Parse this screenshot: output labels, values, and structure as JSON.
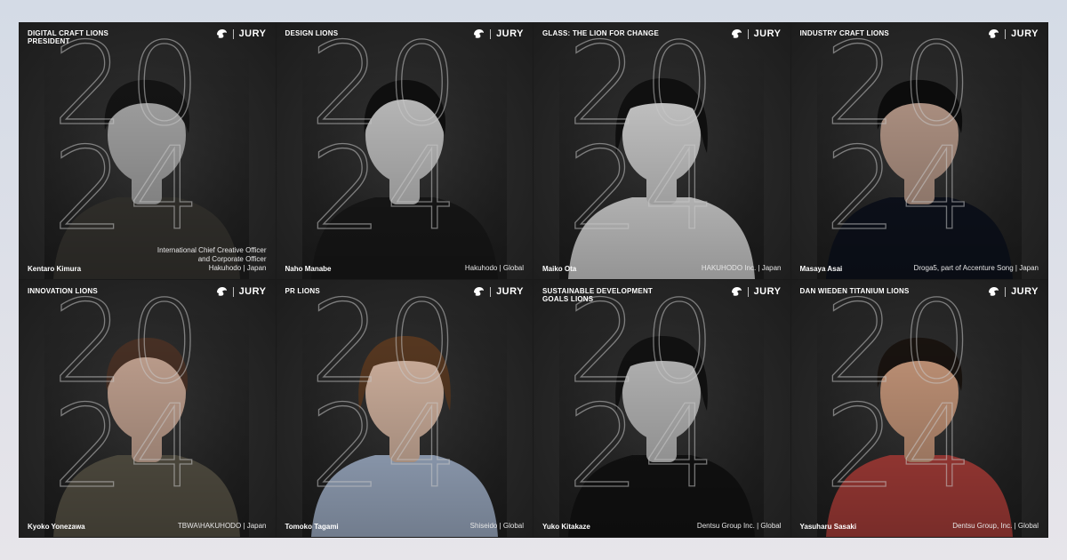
{
  "badge": {
    "label": "JURY"
  },
  "year": {
    "top": "20",
    "bottom": "24"
  },
  "cards": [
    {
      "category": "DIGITAL CRAFT LIONS\nPRESIDENT",
      "name": "Kentaro Kimura",
      "affiliation": "International Chief Creative Officer\nand Corporate Officer\nHakuhodo | Japan",
      "shirt": "#3c3a35",
      "skin": "#a9a9a9",
      "hair": "#151515",
      "hairstyle": "short"
    },
    {
      "category": "DESIGN LIONS",
      "name": "Naho Manabe",
      "affiliation": "Hakuhodo | Global",
      "shirt": "#1b1b1b",
      "skin": "#c4c4c4",
      "hair": "#101010",
      "hairstyle": "pulled"
    },
    {
      "category": "GLASS: THE LION FOR CHANGE",
      "name": "Maiko Ota",
      "affiliation": "HAKUHODO Inc. | Japan",
      "shirt": "#e4e4e4",
      "skin": "#cfcfcf",
      "hair": "#111111",
      "hairstyle": "bob"
    },
    {
      "category": "INDUSTRY CRAFT LIONS",
      "name": "Masaya Asai",
      "affiliation": "Droga5, part of Accenture Song | Japan",
      "shirt": "#0f1420",
      "skin": "#b89a8a",
      "hair": "#0d0d0d",
      "hairstyle": "short"
    },
    {
      "category": "INNOVATION LIONS",
      "name": "Kyoko Yonezawa",
      "affiliation": "TBWA\\HAKUHODO | Japan",
      "shirt": "#5f5a4c",
      "skin": "#c8a795",
      "hair": "#4a3226",
      "hairstyle": "pulled"
    },
    {
      "category": "PR LIONS",
      "name": "Tomoko Tagami",
      "affiliation": "Shiseido | Global",
      "shirt": "#aebfd9",
      "skin": "#d8b8a4",
      "hair": "#5a3a22",
      "hairstyle": "bob"
    },
    {
      "category": "SUSTAINABLE DEVELOPMENT GOALS LIONS",
      "name": "Yuko Kitakaze",
      "affiliation": "Dentsu Group Inc. | Global",
      "shirt": "#141414",
      "skin": "#bdbdbd",
      "hair": "#121212",
      "hairstyle": "bob"
    },
    {
      "category": "DAN WIEDEN TITANIUM LIONS",
      "name": "Yasuharu Sasaki",
      "affiliation": "Dentsu Group, Inc. | Global",
      "shirt": "#b9443f",
      "skin": "#c9997c",
      "hair": "#1a1410",
      "hairstyle": "short"
    }
  ]
}
